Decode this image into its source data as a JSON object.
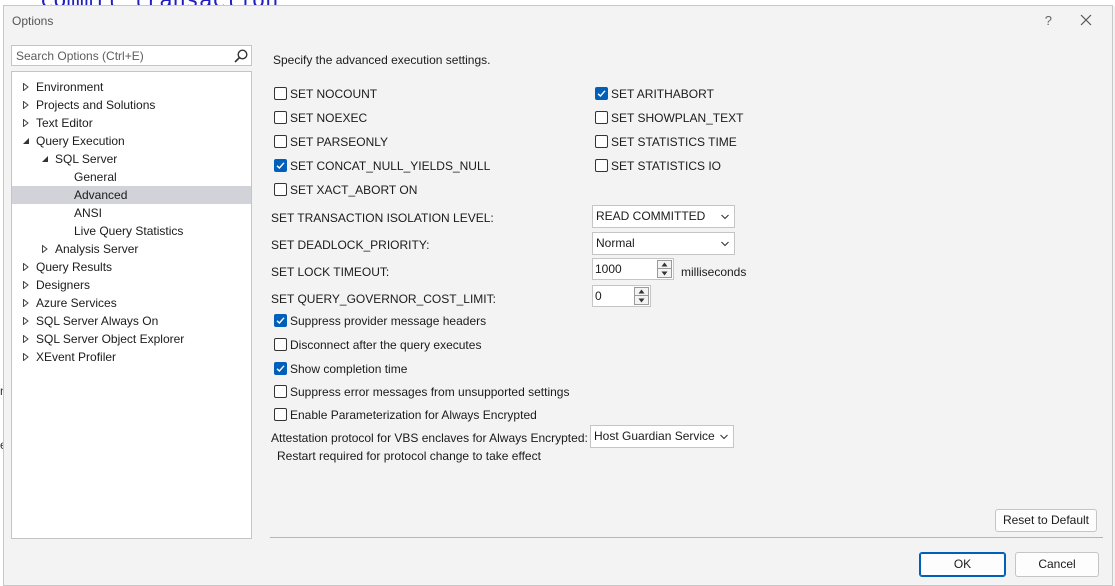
{
  "background": {
    "code_fragment": "commit transaction",
    "edge_letter_1": "n",
    "edge_letter_2": "e"
  },
  "window": {
    "title": "Options",
    "help": "?",
    "close_icon": "close-icon"
  },
  "search": {
    "placeholder": "Search Options (Ctrl+E)",
    "value": "",
    "icon": "search-icon"
  },
  "tree": {
    "items": [
      {
        "label": "Environment",
        "expanded": false,
        "has_children": true,
        "level": 0
      },
      {
        "label": "Projects and Solutions",
        "expanded": false,
        "has_children": true,
        "level": 0
      },
      {
        "label": "Text Editor",
        "expanded": false,
        "has_children": true,
        "level": 0
      },
      {
        "label": "Query Execution",
        "expanded": true,
        "has_children": true,
        "level": 0
      },
      {
        "label": "SQL Server",
        "expanded": true,
        "has_children": true,
        "level": 1
      },
      {
        "label": "General",
        "has_children": false,
        "level": 2
      },
      {
        "label": "Advanced",
        "has_children": false,
        "level": 2,
        "selected": true
      },
      {
        "label": "ANSI",
        "has_children": false,
        "level": 2
      },
      {
        "label": "Live Query Statistics",
        "has_children": false,
        "level": 2
      },
      {
        "label": "Analysis Server",
        "expanded": false,
        "has_children": true,
        "level": 1
      },
      {
        "label": "Query Results",
        "expanded": false,
        "has_children": true,
        "level": 0
      },
      {
        "label": "Designers",
        "expanded": false,
        "has_children": true,
        "level": 0
      },
      {
        "label": "Azure Services",
        "expanded": false,
        "has_children": true,
        "level": 0
      },
      {
        "label": "SQL Server Always On",
        "expanded": false,
        "has_children": true,
        "level": 0
      },
      {
        "label": "SQL Server Object Explorer",
        "expanded": false,
        "has_children": true,
        "level": 0
      },
      {
        "label": "XEvent Profiler",
        "expanded": false,
        "has_children": true,
        "level": 0
      }
    ]
  },
  "content": {
    "heading": "Specify the advanced execution settings.",
    "left_options": [
      {
        "label": "SET NOCOUNT",
        "checked": false
      },
      {
        "label": "SET NOEXEC",
        "checked": false
      },
      {
        "label": "SET PARSEONLY",
        "checked": false
      },
      {
        "label": "SET CONCAT_NULL_YIELDS_NULL",
        "checked": true
      },
      {
        "label": "SET XACT_ABORT ON",
        "checked": false
      }
    ],
    "right_options": [
      {
        "label": "SET ARITHABORT",
        "checked": true
      },
      {
        "label": "SET SHOWPLAN_TEXT",
        "checked": false
      },
      {
        "label": "SET STATISTICS TIME",
        "checked": false
      },
      {
        "label": "SET STATISTICS IO",
        "checked": false
      }
    ],
    "isolation": {
      "label": "SET TRANSACTION ISOLATION LEVEL:",
      "value": "READ COMMITTED"
    },
    "deadlock": {
      "label": "SET DEADLOCK_PRIORITY:",
      "value": "Normal"
    },
    "lock_timeout": {
      "label": "SET LOCK TIMEOUT:",
      "value": "1000",
      "units": "milliseconds"
    },
    "governor": {
      "label": "SET QUERY_GOVERNOR_COST_LIMIT:",
      "value": "0"
    },
    "bottom_options": [
      {
        "label": "Suppress provider message headers",
        "checked": true
      },
      {
        "label": "Disconnect after the query executes",
        "checked": false
      },
      {
        "label": "Show completion time",
        "checked": true
      },
      {
        "label": "Suppress error messages from unsupported settings",
        "checked": false
      },
      {
        "label": "Enable Parameterization for Always Encrypted",
        "checked": false
      }
    ],
    "attestation": {
      "label": "Attestation protocol for VBS enclaves for Always Encrypted:",
      "value": "Host Guardian Service"
    },
    "note": "Restart required for protocol change to take effect",
    "reset_label": "Reset to Default"
  },
  "footer": {
    "ok_label": "OK",
    "cancel_label": "Cancel"
  },
  "colors": {
    "accent": "#005fb8",
    "selection": "#d2d2d9",
    "background": "#f3f3f3"
  }
}
